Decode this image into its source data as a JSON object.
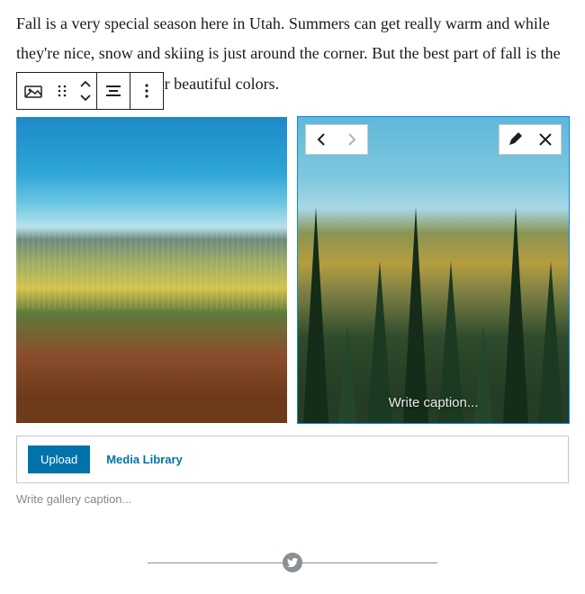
{
  "paragraph": "Fall is a very special season here in Utah. Summers can get really warm and while they're nice, snow and skiing is just around the corner. But the best part of fall is the trees that show off their beautiful colors.",
  "toolbar": {
    "block_type_icon": "gallery-icon",
    "drag_icon": "drag-handle-icon",
    "mover_up_icon": "chevron-up-icon",
    "mover_down_icon": "chevron-down-icon",
    "align_icon": "align-center-icon",
    "more_icon": "more-vertical-icon"
  },
  "gallery": {
    "items": [
      {
        "selected": false,
        "alt": "Autumn aspens with mountain valley view"
      },
      {
        "selected": true,
        "alt": "Pine trees on fall hillside",
        "caption_placeholder": "Write caption..."
      }
    ],
    "selected_overlay": {
      "prev_icon": "chevron-left-icon",
      "next_icon": "chevron-right-icon",
      "next_disabled": true,
      "edit_icon": "pencil-icon",
      "remove_icon": "close-icon"
    }
  },
  "appender": {
    "upload_label": "Upload",
    "media_library_label": "Media Library"
  },
  "gallery_caption_placeholder": "Write gallery caption...",
  "share": {
    "icon": "twitter-icon"
  },
  "colors": {
    "primary": "#0073aa",
    "selection": "#0a84ff"
  }
}
